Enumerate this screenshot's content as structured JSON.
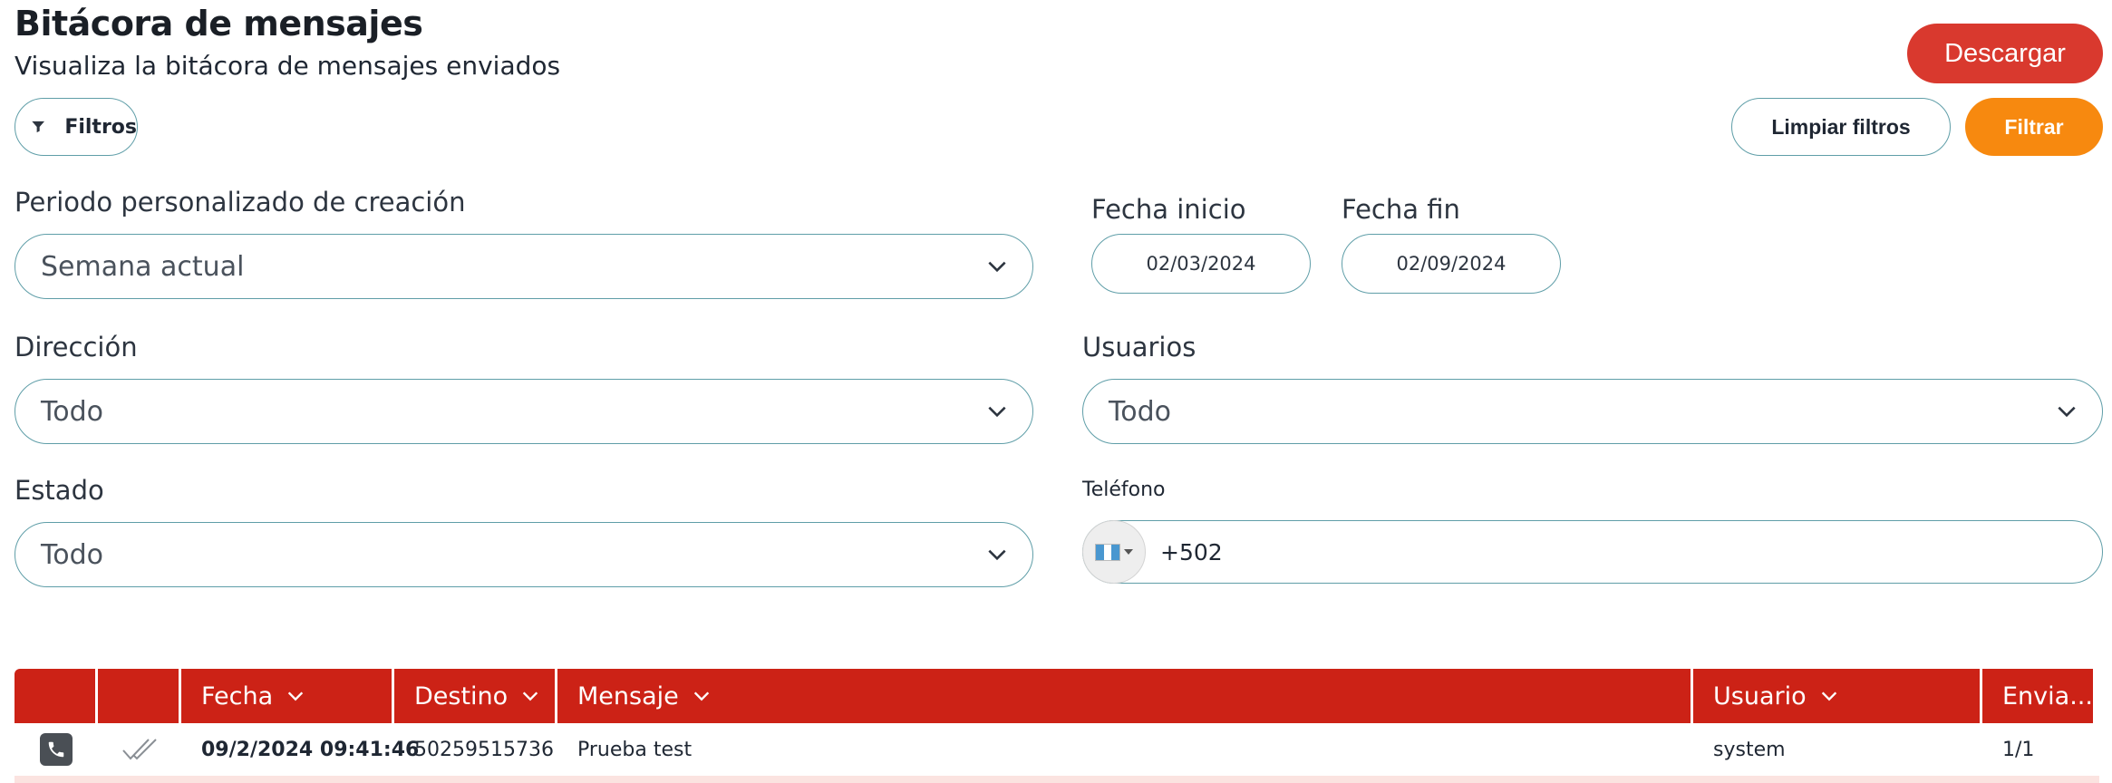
{
  "header": {
    "title": "Bitácora de mensajes",
    "subtitle": "Visualiza la bitácora de mensajes enviados",
    "download_label": "Descargar"
  },
  "toolbar": {
    "filters_label": "Filtros",
    "clear_label": "Limpiar filtros",
    "apply_label": "Filtrar"
  },
  "filters": {
    "period": {
      "label": "Periodo personalizado de creación",
      "value": "Semana actual"
    },
    "start_date": {
      "label": "Fecha inicio",
      "value": "02/03/2024"
    },
    "end_date": {
      "label": "Fecha fin",
      "value": "02/09/2024"
    },
    "direction": {
      "label": "Dirección",
      "value": "Todo"
    },
    "users": {
      "label": "Usuarios",
      "value": "Todo"
    },
    "status": {
      "label": "Estado",
      "value": "Todo"
    },
    "phone": {
      "label": "Teléfono",
      "country_code": "+502",
      "flag": "guatemala-flag"
    }
  },
  "table": {
    "columns": [
      "",
      "",
      "Fecha",
      "Destino",
      "Mensaje",
      "Usuario",
      "Envia..."
    ],
    "rows": [
      {
        "icon": "phone-icon",
        "status_icon": "double-check-icon",
        "fecha": "09/2/2024 09:41:46",
        "destino": "50259515736",
        "mensaje": "Prueba test",
        "usuario": "system",
        "enviados": "1/1"
      }
    ]
  },
  "colors": {
    "accent_red": "#cc2216",
    "download_red": "#d9392e",
    "filter_orange": "#f7890f",
    "outline_teal": "#5f9ea8"
  }
}
